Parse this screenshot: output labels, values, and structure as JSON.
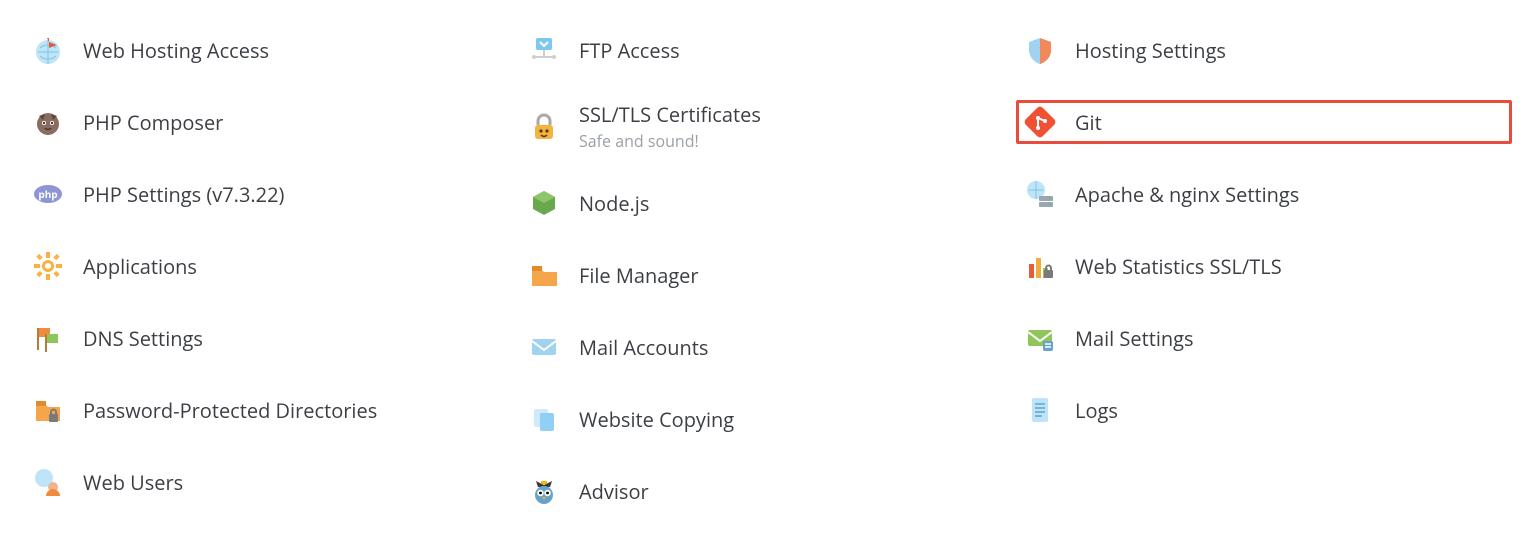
{
  "columns": [
    [
      {
        "id": "web-hosting-access",
        "label": "Web Hosting Access",
        "icon": "globe-flag"
      },
      {
        "id": "php-composer",
        "label": "PHP Composer",
        "icon": "composer"
      },
      {
        "id": "php-settings",
        "label": "PHP Settings (v7.3.22)",
        "icon": "php"
      },
      {
        "id": "applications",
        "label": "Applications",
        "icon": "gear"
      },
      {
        "id": "dns-settings",
        "label": "DNS Settings",
        "icon": "dns-flags"
      },
      {
        "id": "password-protected-directories",
        "label": "Password-Protected Directories",
        "icon": "folder-lock"
      },
      {
        "id": "web-users",
        "label": "Web Users",
        "icon": "user-globe"
      }
    ],
    [
      {
        "id": "ftp-access",
        "label": "FTP Access",
        "icon": "ftp"
      },
      {
        "id": "ssl-tls-certificates",
        "label": "SSL/TLS Certificates",
        "sub": "Safe and sound!",
        "icon": "ssl-lock"
      },
      {
        "id": "node-js",
        "label": "Node.js",
        "icon": "node"
      },
      {
        "id": "file-manager",
        "label": "File Manager",
        "icon": "folder"
      },
      {
        "id": "mail-accounts",
        "label": "Mail Accounts",
        "icon": "mail"
      },
      {
        "id": "website-copying",
        "label": "Website Copying",
        "icon": "copy-doc"
      },
      {
        "id": "advisor",
        "label": "Advisor",
        "icon": "owl"
      }
    ],
    [
      {
        "id": "hosting-settings",
        "label": "Hosting Settings",
        "icon": "shield"
      },
      {
        "id": "git",
        "label": "Git",
        "icon": "git",
        "highlighted": true
      },
      {
        "id": "apache-nginx-settings",
        "label": "Apache & nginx Settings",
        "icon": "server-globe"
      },
      {
        "id": "web-statistics-ssl-tls",
        "label": "Web Statistics SSL/TLS",
        "icon": "stats-lock"
      },
      {
        "id": "mail-settings",
        "label": "Mail Settings",
        "icon": "mail-settings"
      },
      {
        "id": "logs",
        "label": "Logs",
        "icon": "log-doc"
      }
    ]
  ]
}
